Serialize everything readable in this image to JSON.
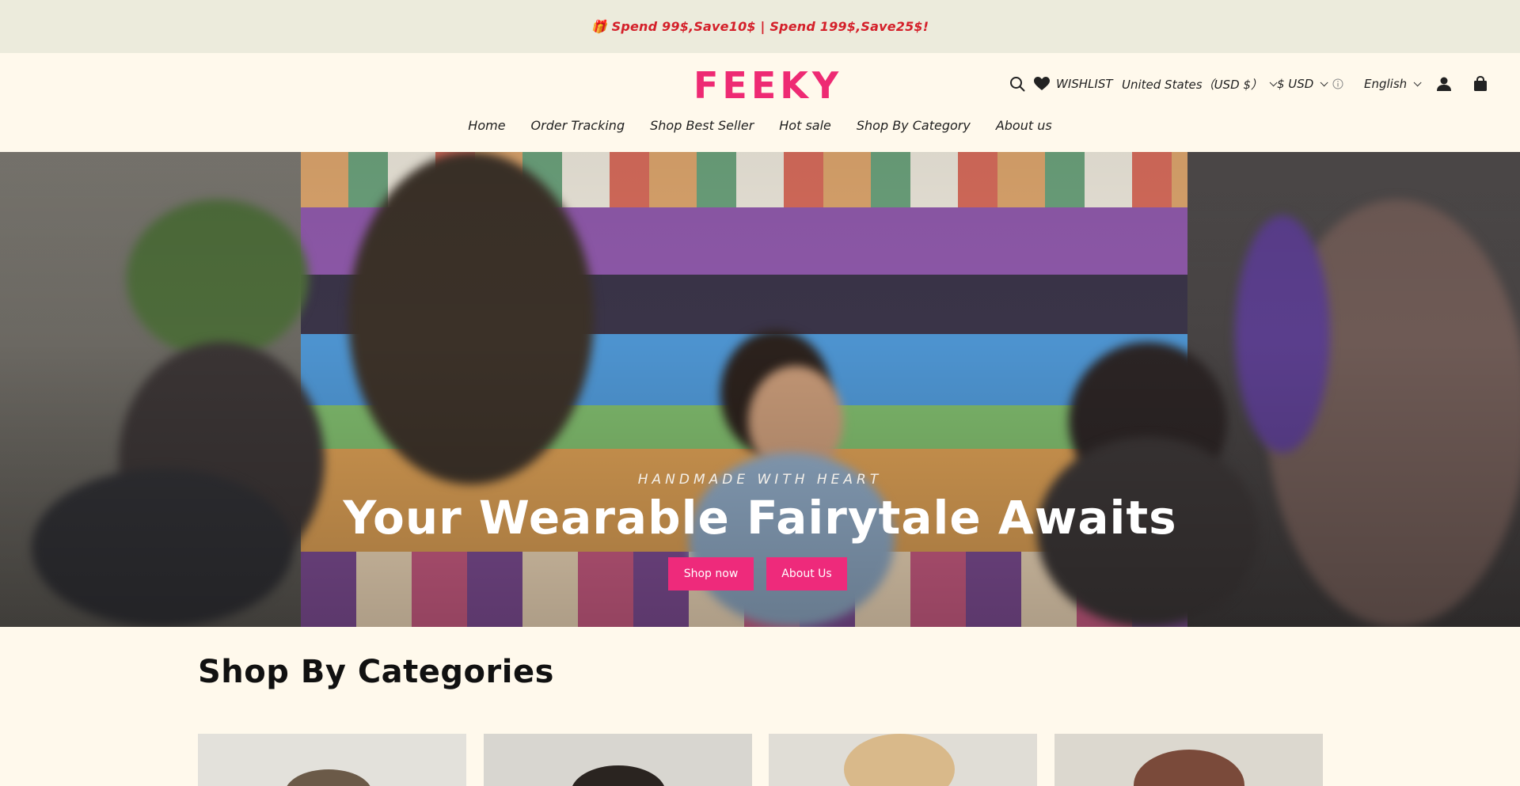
{
  "announcement": {
    "text": "🎁 Spend 99$,Save10$ | Spend 199$,Save25$!"
  },
  "header": {
    "logo": "FEEKY",
    "wishlist": "WISHLIST",
    "region": "United States（USD $）",
    "currency": "$ USD",
    "language": "English",
    "icons": [
      "search-icon",
      "heart-icon",
      "info-icon",
      "account-icon",
      "cart-icon"
    ]
  },
  "nav": {
    "items": [
      "Home",
      "Order Tracking",
      "Shop Best Seller",
      "Hot sale",
      "Shop By Category",
      "About us"
    ]
  },
  "hero": {
    "subtitle": "HANDMADE WITH HEART",
    "title": "Your Wearable Fairytale Awaits",
    "buttons": [
      "Shop now",
      "About Us"
    ]
  },
  "categories": {
    "title": "Shop By Categories"
  },
  "colors": {
    "brand": "#ee2a73",
    "button": "#ee2a7b",
    "announcement_text": "#d4202a",
    "background": "#fff9ec"
  }
}
